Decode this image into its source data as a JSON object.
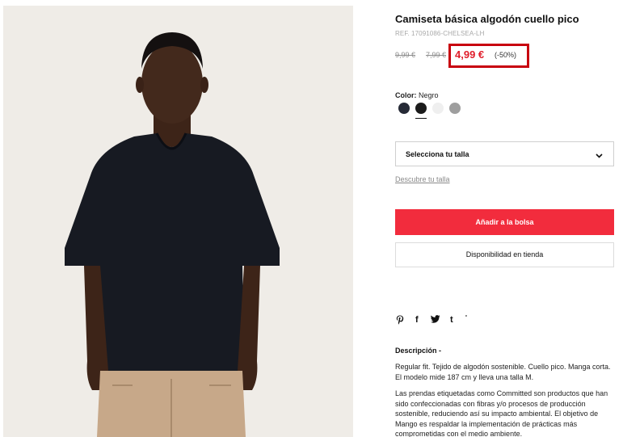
{
  "product": {
    "title": "Camiseta básica algodón cuello pico",
    "ref": "REF. 17091086-CHELSEA-LH",
    "old_price_1": "9,99 €",
    "old_price_2": "7,99 €",
    "price": "4,99 €",
    "discount": "(-50%)",
    "image_alt": "Model wearing black v-neck t-shirt and beige trousers"
  },
  "color": {
    "label": "Color:",
    "selected": "Negro",
    "swatches": [
      {
        "name": "navy",
        "hex": "#262a36"
      },
      {
        "name": "black",
        "hex": "#1b1b1b"
      },
      {
        "name": "white",
        "hex": "#efefef"
      },
      {
        "name": "grey",
        "hex": "#9e9e9e"
      }
    ]
  },
  "size": {
    "select_label": "Selecciona tu talla",
    "guide_link": "Descubre tu talla"
  },
  "actions": {
    "add_to_bag": "Añadir a la bolsa",
    "store_availability": "Disponibilidad en tienda"
  },
  "share": {
    "icons": [
      "pinterest-icon",
      "facebook-icon",
      "twitter-icon",
      "tumblr-icon",
      "more-icon"
    ],
    "glyphs": [
      "P",
      "f",
      "t",
      "t",
      "'"
    ]
  },
  "description": {
    "title": "Descripción  -",
    "paragraph_1": "Regular fit. Tejido de algodón sostenible. Cuello pico. Manga corta. El modelo mide 187 cm y lleva una talla M.",
    "paragraph_2": "Las prendas etiquetadas como Committed son productos que han sido confeccionadas con fibras y/o procesos de producción sostenible, reduciendo así su impacto ambiental. El objetivo de Mango es respaldar la implementación de prácticas más comprometidas con el medio ambiente."
  },
  "colors": {
    "accent_red": "#f22c3d",
    "price_red": "#e01e2b",
    "highlight_border": "#c8000f"
  }
}
